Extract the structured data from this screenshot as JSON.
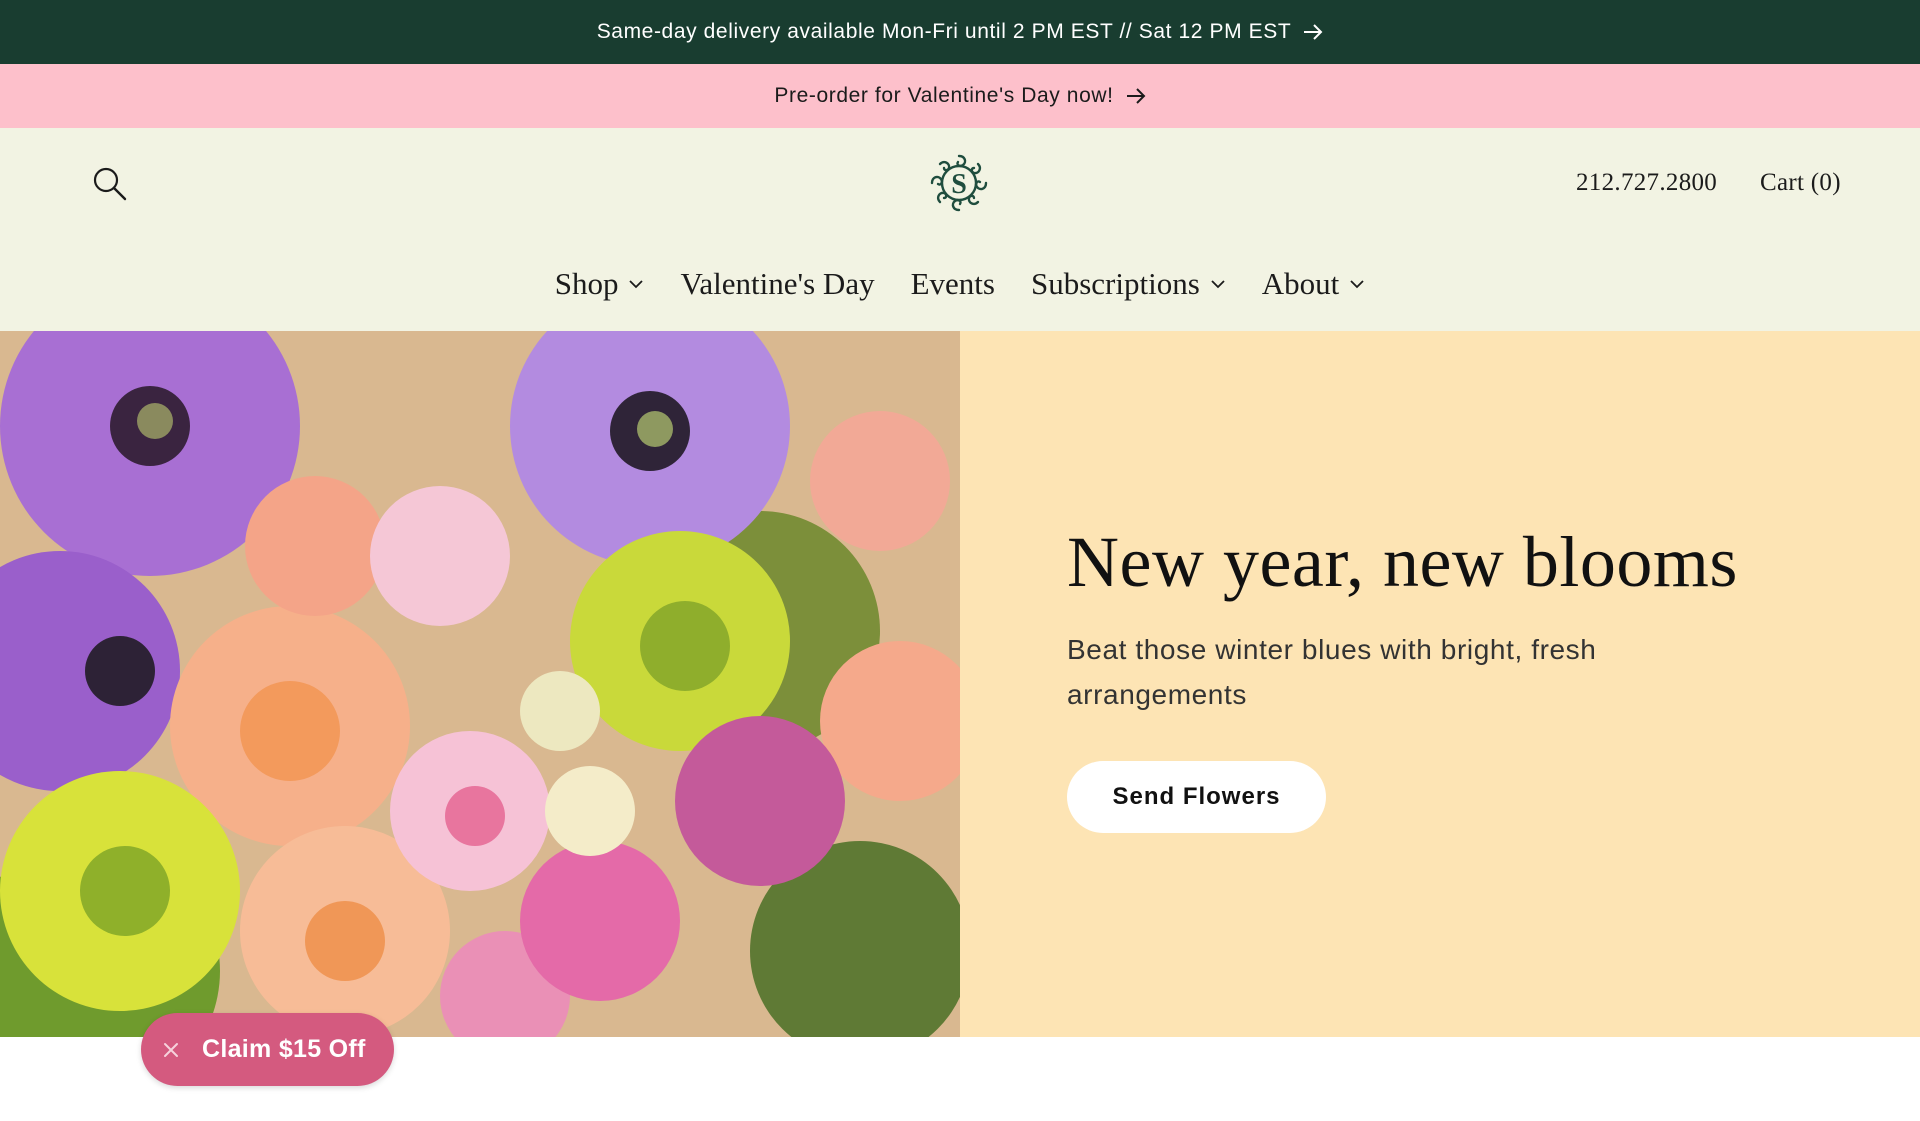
{
  "announcements": {
    "delivery": "Same-day delivery available Mon-Fri until 2 PM EST // Sat 12 PM EST",
    "valentine": "Pre-order for Valentine's Day now!",
    "arrow_icon": "arrow-right-icon"
  },
  "header": {
    "search_icon": "search-icon",
    "logo_letter": "S",
    "phone": "212.727.2800",
    "cart": "Cart (0)"
  },
  "nav": {
    "items": [
      {
        "label": "Shop",
        "has_dropdown": true
      },
      {
        "label": "Valentine's Day",
        "has_dropdown": false
      },
      {
        "label": "Events",
        "has_dropdown": false
      },
      {
        "label": "Subscriptions",
        "has_dropdown": true
      },
      {
        "label": "About",
        "has_dropdown": true
      }
    ]
  },
  "hero": {
    "title": "New year, new blooms",
    "subtitle": "Beat those winter blues with bright, fresh arrangements",
    "button": "Send Flowers"
  },
  "promo": {
    "label": "Claim $15 Off",
    "close_icon": "close-icon"
  },
  "colors": {
    "top_bar": "#193d30",
    "pink_bar": "#fdc0cb",
    "header_bg": "#f2f3e3",
    "hero_panel": "#fde4b4",
    "promo_pill": "#d45a7f"
  }
}
